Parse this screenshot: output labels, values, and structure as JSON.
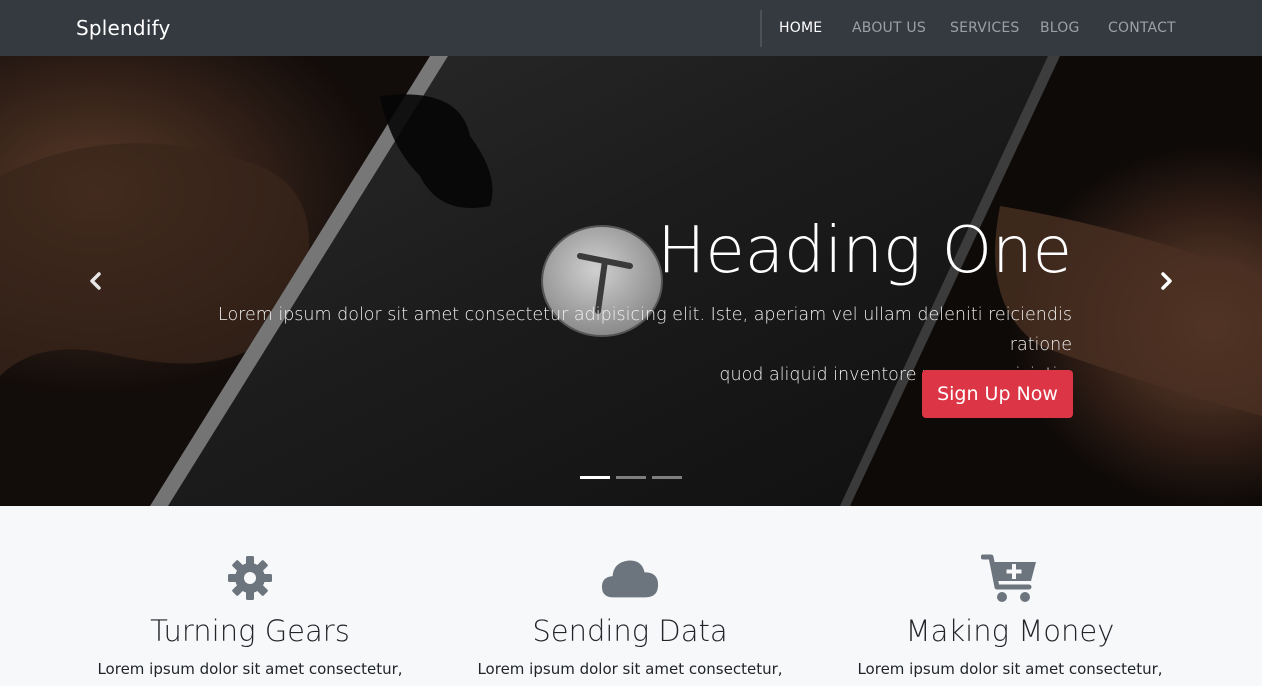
{
  "navbar": {
    "brand": "Splendify",
    "links": [
      {
        "label": "HOME",
        "active": true
      },
      {
        "label": "ABOUT US",
        "active": false
      },
      {
        "label": "SERVICES",
        "active": false
      },
      {
        "label": "BLOG",
        "active": false
      },
      {
        "label": "CONTACT",
        "active": false
      }
    ]
  },
  "hero": {
    "heading": "Heading One",
    "text_line1": "Lorem ipsum dolor sit amet consectetur adipisicing elit. Iste, aperiam vel ullam deleniti reiciendis ratione",
    "text_line2": "quod aliquid inventore vero perspiciatis.",
    "button_label": "Sign Up Now",
    "prev_icon": "chevron-left-icon",
    "next_icon": "chevron-right-icon",
    "slide_count": 3,
    "active_slide": 1
  },
  "features": [
    {
      "icon": "gear-icon",
      "title": "Turning Gears",
      "text": "Lorem ipsum dolor sit amet consectetur,"
    },
    {
      "icon": "cloud-icon",
      "title": "Sending Data",
      "text": "Lorem ipsum dolor sit amet consectetur,"
    },
    {
      "icon": "cart-plus-icon",
      "title": "Making Money",
      "text": "Lorem ipsum dolor sit amet consectetur,"
    }
  ],
  "colors": {
    "navbar_bg": "#343a40",
    "primary_button": "#dc3545",
    "icon_gray": "#6c757d",
    "features_bg": "#f7f8fa"
  }
}
